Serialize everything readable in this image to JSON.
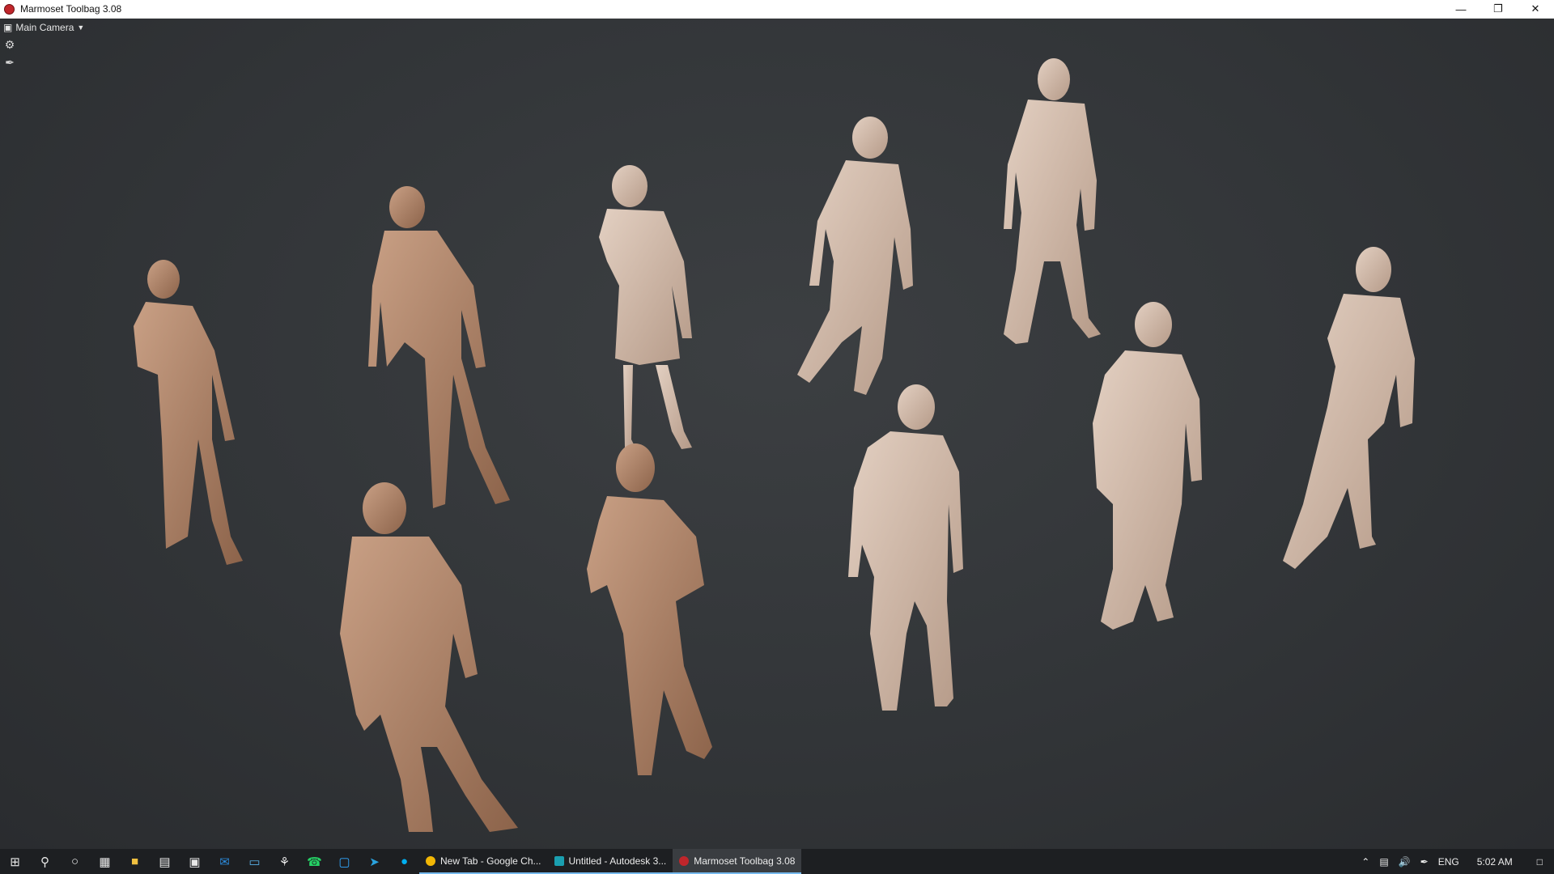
{
  "window": {
    "title": "Marmoset Toolbag 3.08",
    "controls": [
      "minimize-icon",
      "restore-icon",
      "close-icon"
    ]
  },
  "viewport": {
    "camera_label": "Main Camera",
    "tools": [
      "settings-icon",
      "brush-icon"
    ],
    "scene_description_icon": "low-poly-human-figures"
  },
  "taskbar": {
    "pinned_icons": [
      "windows-start-icon",
      "search-icon",
      "cortana-icon",
      "task-view-icon",
      "file-explorer-icon",
      "calculator-icon",
      "store-icon",
      "mail-icon",
      "remote-desktop-icon",
      "network-icon",
      "whatsapp-icon",
      "photoshop-icon",
      "telegram-icon",
      "skype-icon"
    ],
    "apps": [
      {
        "label": "New Tab - Google Ch...",
        "icon_color": "#f2b705",
        "active": false
      },
      {
        "label": "Untitled - Autodesk 3...",
        "icon_color": "#1a9fb0",
        "active": false
      },
      {
        "label": "Marmoset Toolbag 3.08",
        "icon_color": "#c0262b",
        "active": true
      }
    ],
    "tray": {
      "language": "ENG",
      "time": "5:02 AM"
    }
  },
  "colors": {
    "viewport_bg": "#303336",
    "figure_light": "#d8c2b1",
    "figure_dark": "#8c634a"
  }
}
